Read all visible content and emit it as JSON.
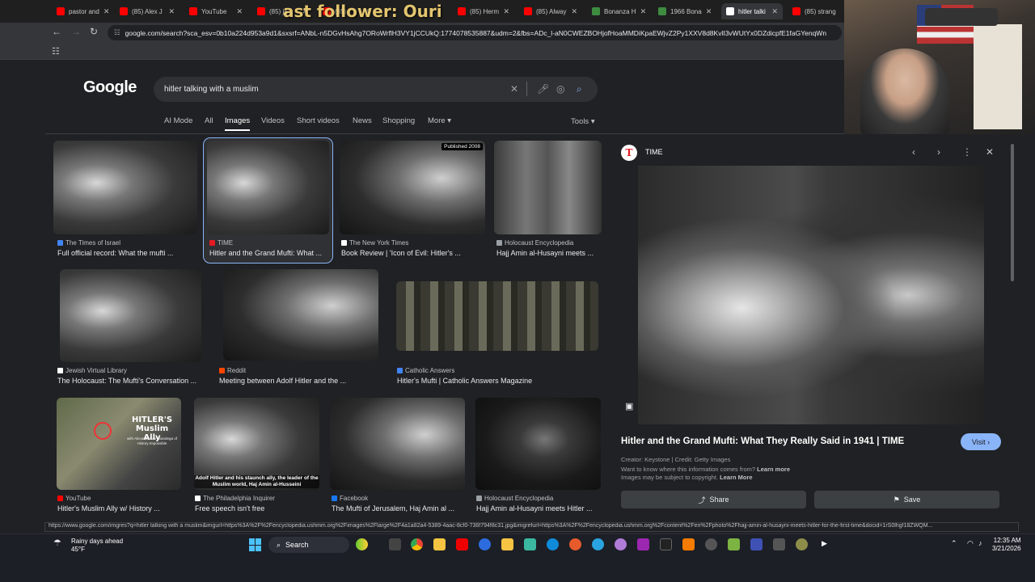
{
  "tabs": [
    {
      "label": "pastor and",
      "color": "#ff0000"
    },
    {
      "label": "(85) Alex J",
      "color": "#ff0000"
    },
    {
      "label": "YouTube",
      "color": "#ff0000"
    },
    {
      "label": "(85) ja",
      "color": "#ff0000"
    },
    {
      "label": "(85)",
      "color": "#ff0000"
    },
    {
      "label": "(85) Herm",
      "color": "#ff0000"
    },
    {
      "label": "(85) Alway",
      "color": "#ff0000"
    },
    {
      "label": "Bonanza H",
      "color": "#3d8c40"
    },
    {
      "label": "1966 Bona",
      "color": "#3d8c40"
    },
    {
      "label": "hitler talki",
      "color": "#ffffff",
      "active": true
    },
    {
      "label": "(85) strang",
      "color": "#ff0000"
    }
  ],
  "overlay_text": "ast follower: Ouri",
  "address_bar": {
    "url": "google.com/search?sca_esv=0b10a224d953a9d1&sxsrf=ANbL-n5DGvHsAhg7ORoWrflH3VY1jCCUkQ:1774078535887&udm=2&fbs=ADc_l-aN0CWEZBOHjofHoaMMDiKpaEWjvZ2Py1XXV8d8KvlI3vWUtYx0DZdicpfE1faGYenqWn"
  },
  "search": {
    "logo": "Google",
    "query": "hitler talking with a muslim",
    "filters": [
      "AI Mode",
      "All",
      "Images",
      "Videos",
      "Short videos",
      "News",
      "Shopping",
      "More"
    ],
    "selected_filter": "Images",
    "tools_label": "Tools"
  },
  "results": [
    {
      "source": "The Times of Israel",
      "caption": "Full official record: What the mufti ...",
      "src_color": "#4285f4"
    },
    {
      "source": "TIME",
      "caption": "Hitler and the Grand Mufti: What ...",
      "src_color": "#e31b23",
      "selected": true
    },
    {
      "source": "The New York Times",
      "caption": "Book Review | 'Icon of Evil: Hitler's ...",
      "src_color": "#ffffff",
      "badge": "Published 2008"
    },
    {
      "source": "Holocaust Encyclopedia",
      "caption": "Hajj Amin al-Husayni meets ...",
      "src_color": "#9aa0a6"
    },
    {
      "source": "Jewish Virtual Library",
      "caption": "The Holocaust: The Mufti's Conversation ...",
      "src_color": "#ffffff"
    },
    {
      "source": "Reddit",
      "caption": "Meeting between Adolf Hitler and the ...",
      "src_color": "#ff4500"
    },
    {
      "source": "Catholic Answers",
      "caption": "Hitler's Mufti | Catholic Answers Magazine",
      "src_color": "#4285f4"
    },
    {
      "source": "YouTube",
      "caption": "Hitler's Muslim Ally w/ History ...",
      "src_color": "#ff0000",
      "overlay": "HITLER'S Muslim Ally",
      "overlay_sub": "with Alexander von Sandega of History Impossible"
    },
    {
      "source": "The Philadelphia Inquirer",
      "caption": "Free speech isn't free",
      "src_color": "#ffffff",
      "overlay": "Adolf Hitler and his staunch ally, the leader of the Muslim world, Haj Amin al-Husseini"
    },
    {
      "source": "Facebook",
      "caption": "The Mufti of Jerusalem, Haj Amin al ...",
      "src_color": "#1877f2"
    },
    {
      "source": "Holocaust Encyclopedia",
      "caption": "Hajj Amin al-Husayni meets Hitler ...",
      "src_color": "#9aa0a6"
    }
  ],
  "preview": {
    "source": "TIME",
    "logo_letter": "T",
    "title": "Hitler and the Grand Mufti: What They Really Said in 1941 | TIME",
    "visit_label": "Visit",
    "credit": "Creator: Keystone | Credit: Getty Images",
    "info_q": "Want to know where this information comes from?",
    "info_link": "Learn more",
    "copyright": "Images may be subject to copyright.",
    "copyright_link": "Learn More",
    "share_label": "Share",
    "save_label": "Save"
  },
  "status_url": "https://www.google.com/imgres?q=hitler talking with a muslim&imgurl=https%3A%2F%2Fencyclopedia.ushmm.org%2Fimages%2Flarge%2F4a1a82a4-5389-4aac-8cf0-736f794f8c31.jpg&imgrefurl=https%3A%2F%2Fencyclopedia.ushmm.org%2Fcontent%2Fen%2Fphoto%2Fhajj-amin-al-husayni-meets-hitler-for-the-first-time&docid=1rS0lhgf18ZWQM...",
  "taskbar": {
    "weather_title": "Rainy days ahead",
    "weather_temp": "45°F",
    "search_label": "Search",
    "time": "12:35 AM",
    "date": "3/21/2026"
  }
}
